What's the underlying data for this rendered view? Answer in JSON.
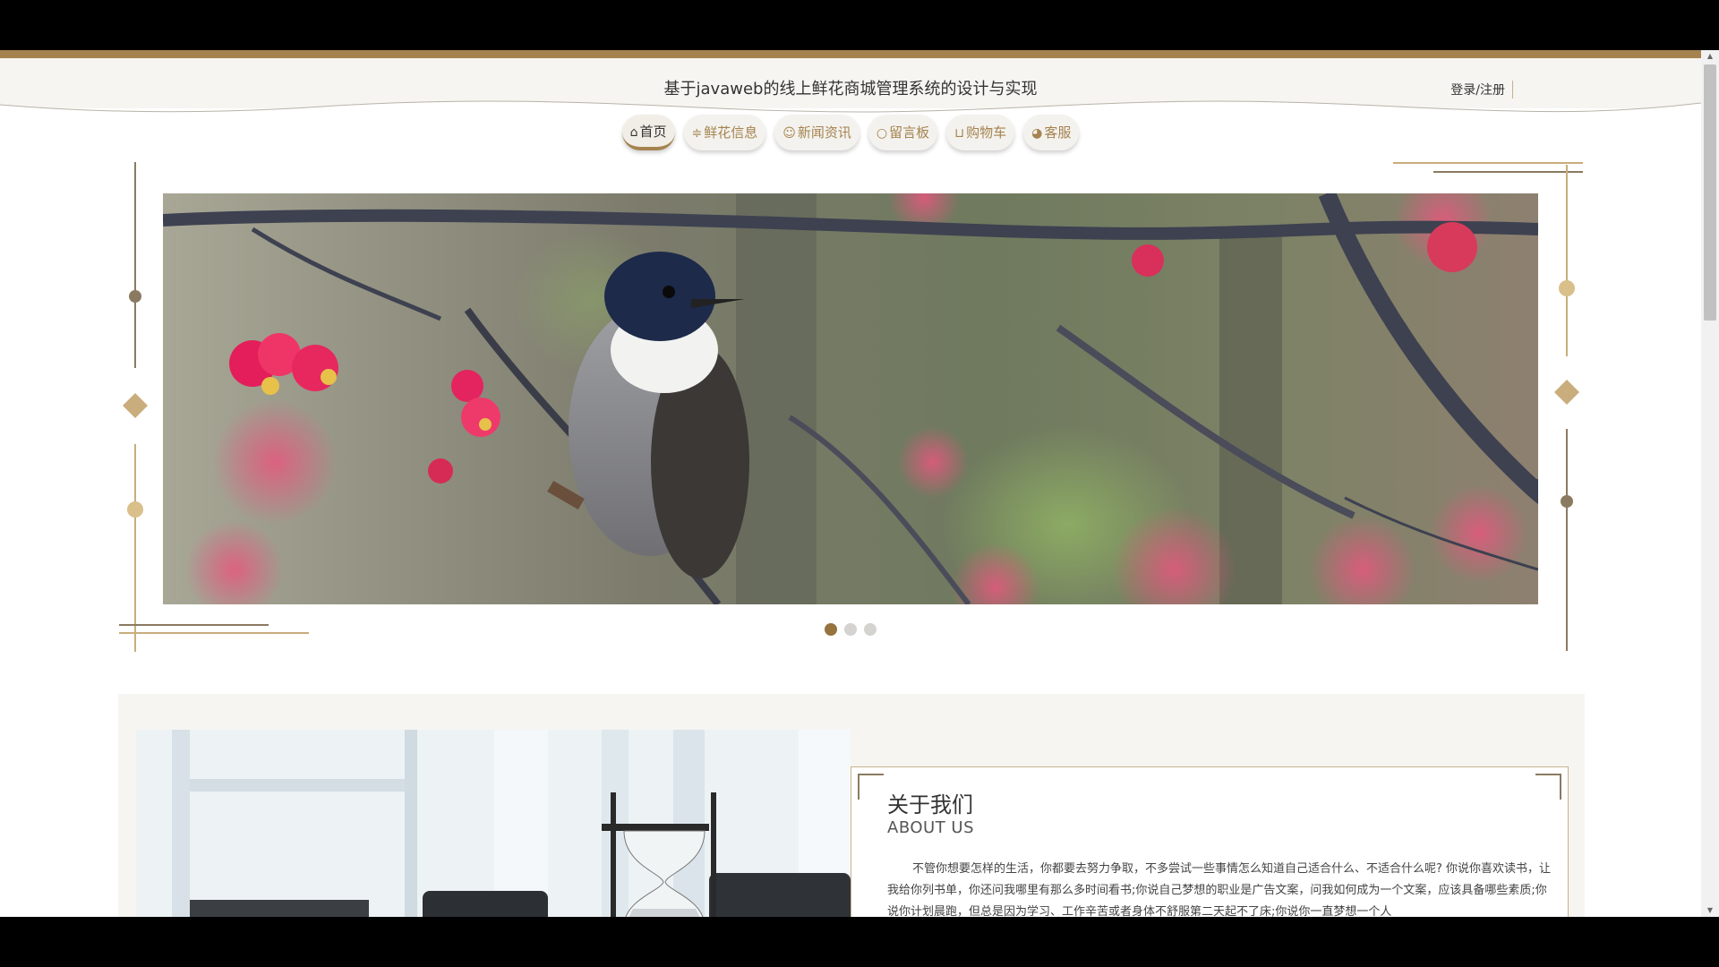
{
  "header": {
    "site_title": "基于javaweb的线上鲜花商城管理系统的设计与实现",
    "login_link": "登录/注册"
  },
  "nav": {
    "items": [
      {
        "label": "首页",
        "icon": "home-icon",
        "active": true
      },
      {
        "label": "鲜花信息",
        "icon": "sliders-icon",
        "active": false
      },
      {
        "label": "新闻资讯",
        "icon": "news-icon",
        "active": false
      },
      {
        "label": "留言板",
        "icon": "message-icon",
        "active": false
      },
      {
        "label": "购物车",
        "icon": "cart-icon",
        "active": false
      },
      {
        "label": "客服",
        "icon": "service-icon",
        "active": false
      }
    ]
  },
  "carousel": {
    "image": "bird-on-blossom-branch",
    "slide_count": 3,
    "active_index": 0
  },
  "about": {
    "title": "关于我们",
    "subtitle": "ABOUT US",
    "text": "不管你想要怎样的生活，你都要去努力争取，不多尝试一些事情怎么知道自己适合什么、不适合什么呢? 你说你喜欢读书，让我给你列书单，你还问我哪里有那么多时间看书;你说自己梦想的职业是广告文案，问我如何成为一个文案，应该具备哪些素质;你说你计划晨跑，但总是因为学习、工作辛苦或者身体不舒服第二天起不了床;你说你一直梦想一个人"
  },
  "colors": {
    "accent": "#a5834f",
    "header_bg": "#f6f5f1",
    "dot_active": "#96733f"
  }
}
